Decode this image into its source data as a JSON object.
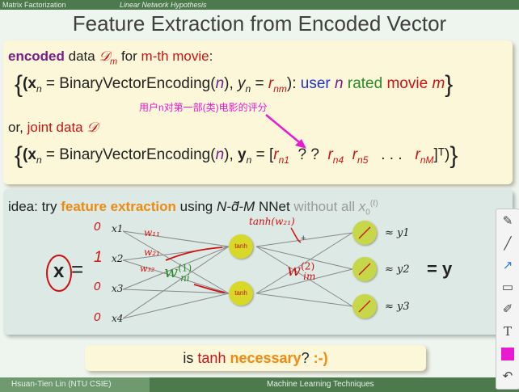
{
  "header": {
    "section": "Matrix Factorization",
    "subsection": "Linear Network Hypothesis"
  },
  "title": "Feature Extraction from Encoded Vector",
  "box1": {
    "w_encoded": "encoded",
    "w_data": "data",
    "w_dm": "𝒟",
    "w_dm_sub": "m",
    "w_for": "for",
    "w_mth": "m-th movie",
    "w_colon": ":",
    "set1_lb": "{",
    "set1_x": "(x",
    "set1_xn": "n",
    "set1_eq": " = BinaryVectorEncoding(",
    "set1_n": "n",
    "set1_c": "), ",
    "set1_y": "y",
    "set1_yn": "n",
    "set1_eq2": " = ",
    "set1_r": "r",
    "set1_rsub": "nm",
    "set1_rp": "):",
    "set1_user": "user",
    "set1_n2": "n",
    "set1_rated": "rated",
    "set1_movie": "movie",
    "set1_m": "m",
    "set1_rb": "}",
    "chinese_note": "用户n对第一部(类)电影的评分",
    "or_text": "or,",
    "joint": "joint data",
    "joint_d": "𝒟",
    "set2_lb": "{",
    "set2_x": "(x",
    "set2_xn": "n",
    "set2_eq": " = BinaryVectorEncoding(",
    "set2_n": "n",
    "set2_c": "), ",
    "set2_y": "y",
    "set2_yn": "n",
    "set2_eq2": " = [",
    "set2_r1": "r",
    "set2_r1sub": "n1",
    "set2_qq": "?   ?",
    "set2_r4": "r",
    "set2_r4sub": "n4",
    "set2_r5": "r",
    "set2_r5sub": "n5",
    "set2_dots": ". . .",
    "set2_rM": "r",
    "set2_rMsub": "nM",
    "set2_T": "]ᵀ)",
    "set2_rb": "}"
  },
  "box2": {
    "idea": "idea: try",
    "fe": "feature extraction",
    "using": "using",
    "ndm": "N-d̃-M",
    "nnet": "NNet",
    "without": "without all",
    "x0": "x",
    "x0_sub": "0",
    "x0_sup": "(ℓ)",
    "input_labels": [
      "x1",
      "x2",
      "x3",
      "x4"
    ],
    "tanh": "tanh",
    "w1": "w",
    "w1_sub": "ni",
    "w1_sup": "(1)",
    "w2": "w",
    "w2_sub": "im",
    "w2_sup": "(2)",
    "outputs": [
      "≈ y1",
      "≈ y2",
      "≈ y3"
    ],
    "eq_y": "= y",
    "big_x": "x",
    "big_eq": "=",
    "hand_vals": [
      "0",
      "1",
      "0",
      "0"
    ]
  },
  "box3": {
    "pre": "is",
    "tanh": "tanh",
    "necessary": "necessary",
    "q": "?",
    "smile": ":-)"
  },
  "footer": {
    "author": "Hsuan-Tien Lin  (NTU CSIE)",
    "course": "Machine Learning Techniques"
  },
  "toolbar": [
    "pen-tool",
    "line-tool",
    "arrow-tool",
    "rectangle-tool",
    "highlighter-tool",
    "text-tool",
    "color-swatch",
    "undo-tool"
  ],
  "colors": {
    "accent_green": "#4d7a4d",
    "box_yellow": "#fbf7d8",
    "box_green": "#dce9e4",
    "pink": "#e81bd0",
    "orange": "#ee8a10"
  }
}
